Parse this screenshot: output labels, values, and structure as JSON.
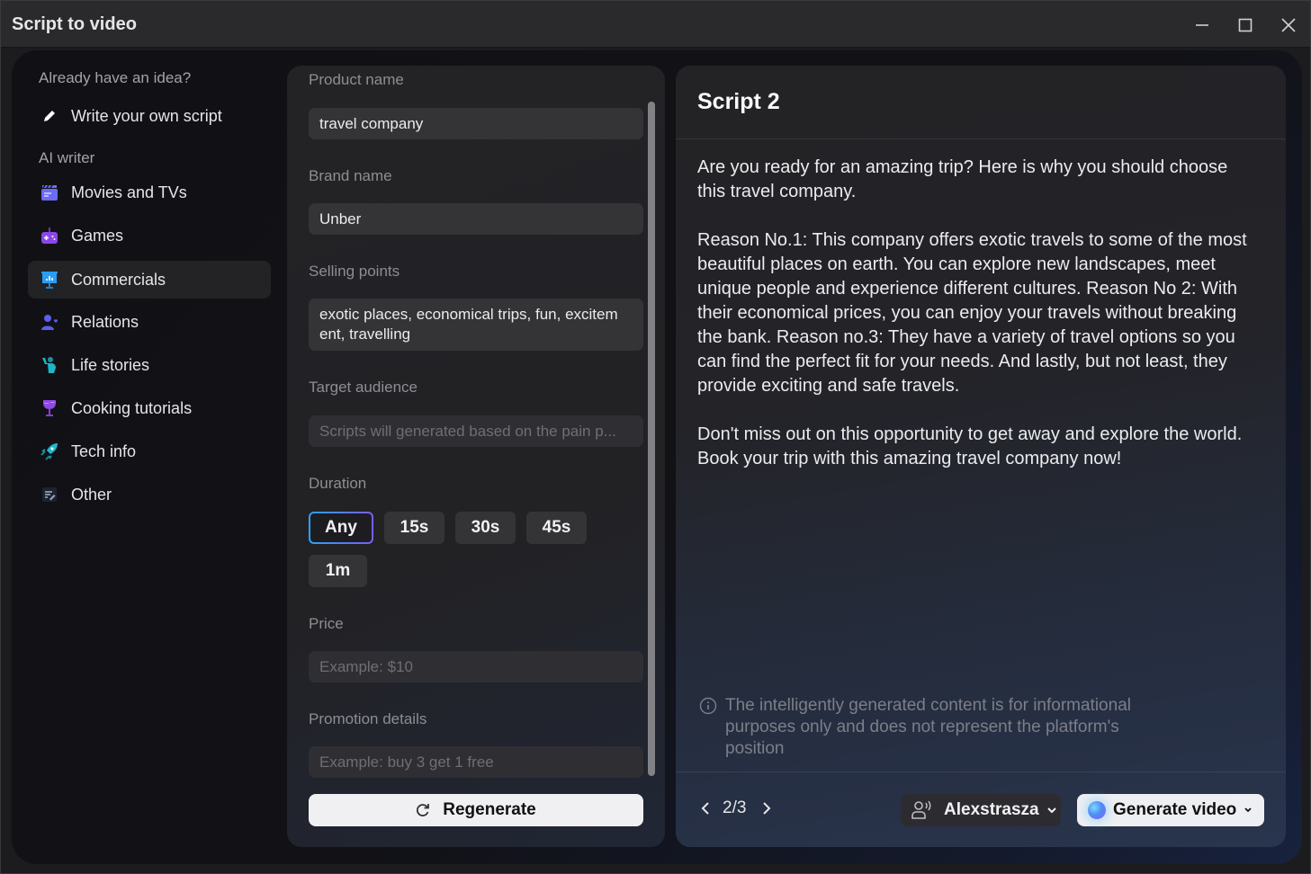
{
  "window": {
    "title": "Script to video",
    "controls": {
      "minimize": "minimize-icon",
      "maximize": "maximize-icon",
      "close": "close-icon"
    }
  },
  "sidebar": {
    "idea_heading": "Already have an idea?",
    "write_own": {
      "label": "Write your own script",
      "icon": "pencil-icon"
    },
    "ai_heading": "AI writer",
    "items": [
      {
        "label": "Movies and TVs",
        "icon": "clapperboard-icon",
        "color": "#6b6cf6",
        "active": false
      },
      {
        "label": "Games",
        "icon": "gamepad-icon",
        "color": "#8b46e8",
        "active": false
      },
      {
        "label": "Commercials",
        "icon": "presentation-chart-icon",
        "color": "#2a9df4",
        "active": true
      },
      {
        "label": "Relations",
        "icon": "person-heart-icon",
        "color": "#5b5ef0",
        "active": false
      },
      {
        "label": "Life stories",
        "icon": "person-waving-icon",
        "color": "#1fb5c8",
        "active": false
      },
      {
        "label": "Cooking tutorials",
        "icon": "wine-glass-icon",
        "color": "#9147e6",
        "active": false
      },
      {
        "label": "Tech info",
        "icon": "rocket-icon",
        "color": "#21b7c9",
        "active": false
      },
      {
        "label": "Other",
        "icon": "notes-edit-icon",
        "color": "#9aa3c0",
        "active": false
      }
    ]
  },
  "form": {
    "product_name": {
      "label": "Product name",
      "value": "travel company"
    },
    "brand_name": {
      "label": "Brand name",
      "value": "Unber"
    },
    "selling_points": {
      "label": "Selling points",
      "value": "exotic places, economical trips, fun, excitem ent, travelling"
    },
    "target_audience": {
      "label": "Target audience",
      "placeholder": "Scripts will generated based on the pain p..."
    },
    "duration": {
      "label": "Duration",
      "options": [
        "Any",
        "15s",
        "30s",
        "45s",
        "1m"
      ],
      "selected": "Any"
    },
    "price": {
      "label": "Price",
      "placeholder": "Example: $10"
    },
    "promotion": {
      "label": "Promotion details",
      "placeholder": "Example: buy 3 get 1 free"
    },
    "regenerate_label": "Regenerate"
  },
  "script": {
    "title": "Script 2",
    "paragraphs": [
      "Are you ready for an amazing trip? Here is why you should choose this travel company.",
      "Reason No.1: This company offers exotic travels to some of the most beautiful places on earth. You can explore new landscapes, meet unique people and experience different cultures. Reason No 2: With their economical prices, you can enjoy your travels without breaking the bank. Reason no.3: They have a variety of travel options so you can find the perfect fit for your needs. And lastly, but not least, they provide exciting and safe travels.",
      "Don't miss out on this opportunity to get away and explore the world. Book your trip with this amazing travel company now!"
    ],
    "disclaimer": "The intelligently generated content is for informational purposes only and does not represent the platform's position",
    "pager": "2/3",
    "voice_label": "Alexstrasza",
    "generate_label": "Generate video"
  },
  "colors": {
    "accent_start": "#2aa3f5",
    "accent_end": "#7b5cf5"
  }
}
